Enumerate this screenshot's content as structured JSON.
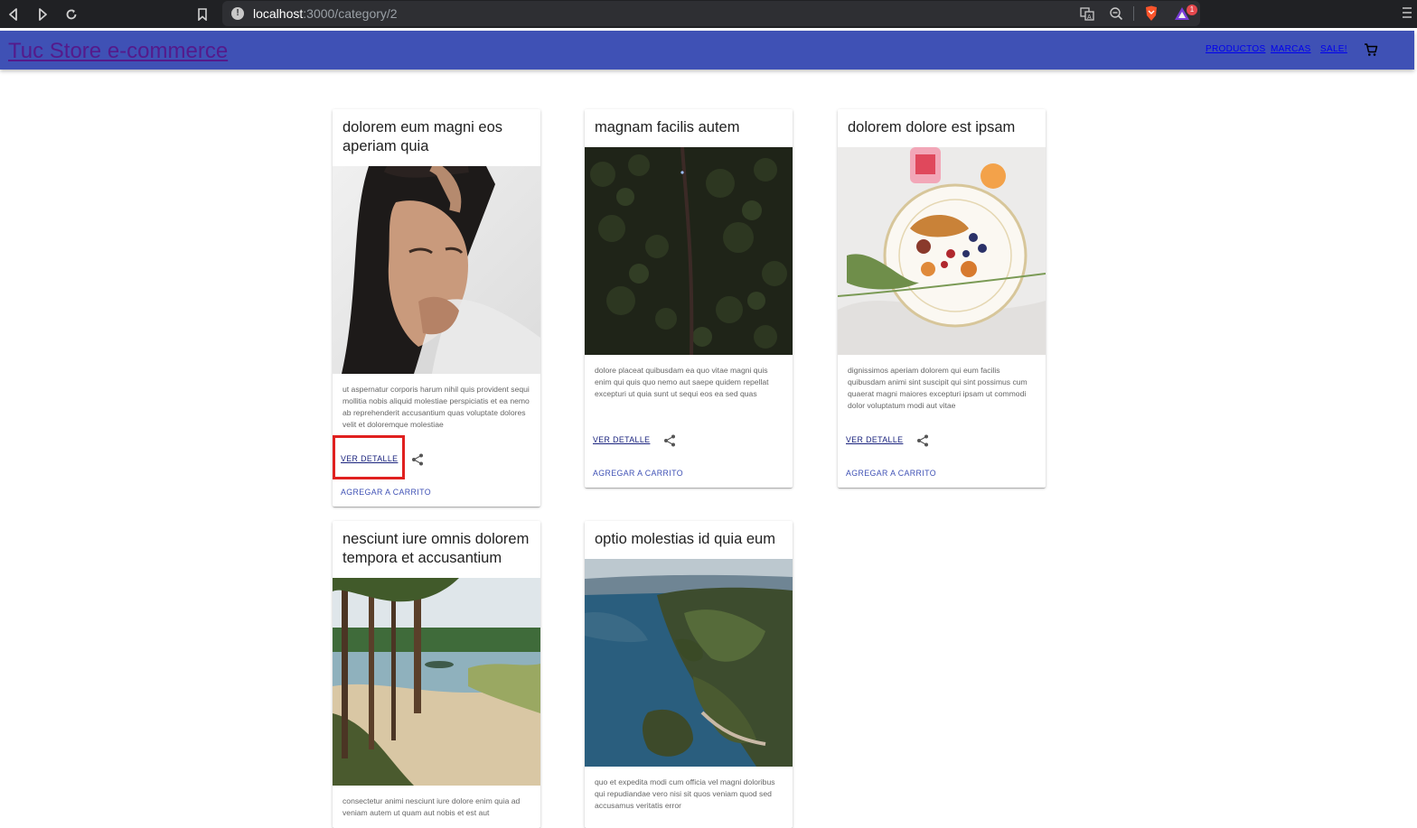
{
  "browser": {
    "url_host": "localhost",
    "url_path": ":3000/category/2",
    "notification_count": "1"
  },
  "header": {
    "brand": "Tuc Store e-commerce",
    "nav": [
      "PRODUCTOS",
      "MARCAS",
      "SALE!"
    ]
  },
  "products": [
    {
      "title": "dolorem eum magni eos aperiam quia",
      "description": "ut aspernatur corporis harum nihil quis provident sequi mollitia nobis aliquid molestiae perspiciatis et ea nemo ab reprehenderit accusantium quas voluptate dolores velit et doloremque molestiae",
      "view_label": "VER DETALLE",
      "cart_label": "AGREGAR A CARRITO",
      "image": "woman-with-veil"
    },
    {
      "title": "magnam facilis autem",
      "description": "dolore placeat quibusdam ea quo vitae magni quis enim qui quis quo nemo aut saepe quidem repellat excepturi ut quia sunt ut sequi eos ea sed quas",
      "view_label": "VER DETALLE",
      "cart_label": "AGREGAR A CARRITO",
      "image": "aerial-forest"
    },
    {
      "title": "dolorem dolore est ipsam",
      "description": "dignissimos aperiam dolorem qui eum facilis quibusdam animi sint suscipit qui sint possimus cum quaerat magni maiores excepturi ipsam ut commodi dolor voluptatum modi aut vitae",
      "view_label": "VER DETALLE",
      "cart_label": "AGREGAR A CARRITO",
      "image": "breakfast-plate"
    },
    {
      "title": "nesciunt iure omnis dolorem tempora et accusantium",
      "description": "consectetur animi nesciunt iure dolore enim quia ad veniam autem ut quam aut nobis et est aut",
      "image": "lake-pines"
    },
    {
      "title": "optio molestias id quia eum",
      "description": "quo et expedita modi cum officia vel magni doloribus qui repudiandae vero nisi sit quos veniam quod sed accusamus veritatis error",
      "image": "coastal-island"
    }
  ],
  "colors": {
    "header_bg": "#3f51b5",
    "highlight": "#e0201f"
  }
}
